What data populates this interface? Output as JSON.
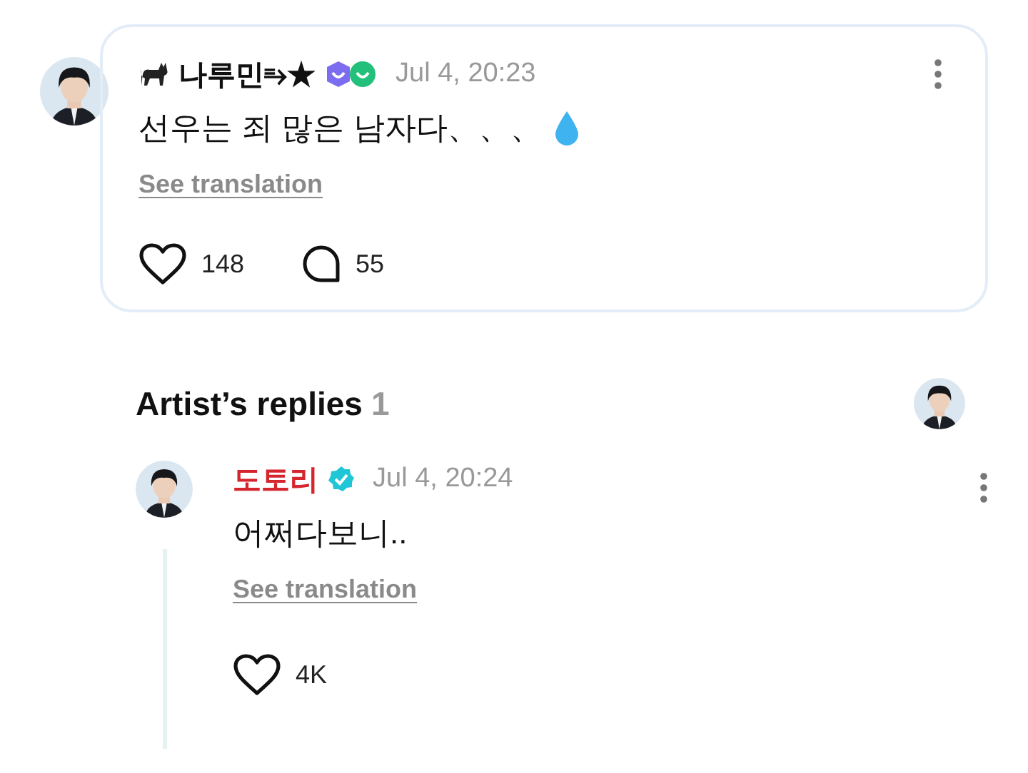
{
  "comment": {
    "author": "나루민⥱★",
    "time": "Jul 4, 20:23",
    "text": "선우는 죄 많은 남자다、、、",
    "translation_link": "See translation",
    "likes": "148",
    "replies": "55",
    "liked": false
  },
  "artist_replies": {
    "title": "Artist’s replies",
    "count": "1"
  },
  "reply": {
    "author": "도토리",
    "verified": true,
    "time": "Jul 4, 20:24",
    "text": "어쩌다보니..",
    "translation_link": "See translation",
    "likes": "4K",
    "liked": false
  }
}
